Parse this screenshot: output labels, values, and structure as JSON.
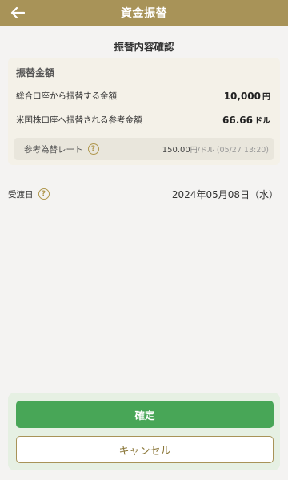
{
  "header": {
    "title": "資金振替",
    "back_icon": "arrow-left-icon"
  },
  "section_title": "振替内容確認",
  "transfer_card": {
    "title": "振替金額",
    "rows": [
      {
        "label": "総合口座から振替する金額",
        "amount": "10,000",
        "unit": "円"
      },
      {
        "label": "米国株口座へ振替される参考金額",
        "amount": "66.66",
        "unit": "ドル"
      }
    ],
    "rate": {
      "label": "参考為替レート",
      "value": "150.00",
      "unit": "円/ドル",
      "timestamp": "(05/27 13:20)"
    }
  },
  "settlement": {
    "label": "受渡日",
    "value": "2024年05月08日（水）"
  },
  "footer": {
    "confirm_label": "確定",
    "cancel_label": "キャンセル"
  },
  "colors": {
    "header": "#a89358",
    "confirm": "#48a657",
    "accent": "#b0974e"
  }
}
